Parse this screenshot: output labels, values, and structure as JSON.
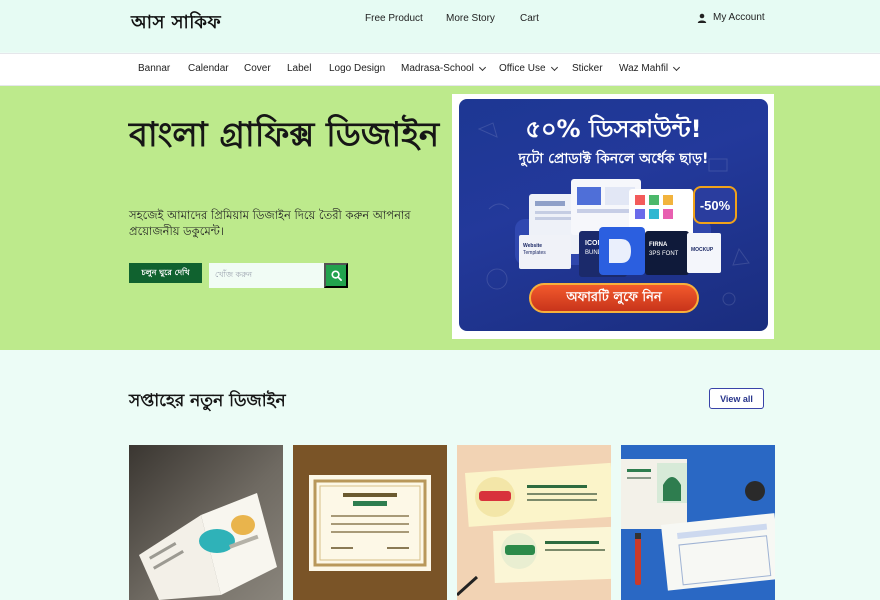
{
  "header": {
    "logo": "আস সাকিফ",
    "nav": [
      "Free Product",
      "More Story",
      "Cart"
    ],
    "account_label": "My Account"
  },
  "categories": [
    {
      "label": "Bannar",
      "has_dropdown": false
    },
    {
      "label": "Calendar",
      "has_dropdown": false
    },
    {
      "label": "Cover",
      "has_dropdown": false
    },
    {
      "label": "Label",
      "has_dropdown": false
    },
    {
      "label": "Logo Design",
      "has_dropdown": false
    },
    {
      "label": "Madrasa-School",
      "has_dropdown": true
    },
    {
      "label": "Office Use",
      "has_dropdown": true
    },
    {
      "label": "Sticker",
      "has_dropdown": false
    },
    {
      "label": "Waz Mahfil",
      "has_dropdown": true
    }
  ],
  "hero": {
    "title": "বাংলা গ্রাফিক্স ডিজাইন",
    "subtitle": "সহজেই আমাদের প্রিমিয়াম ডিজাইন দিয়ে তৈরী করুন আপনার প্রয়োজনীয় ডকুমেন্ট।",
    "explore_button": "চলুন ঘুরে দেখি",
    "search_placeholder": "খোঁজ করুন"
  },
  "promo": {
    "headline": "৫০% ডিসকাউন্ট!",
    "subline": "দুটো প্রোডাক্ট কিনলে অর্ধেক ছাড়!",
    "badge": "-50%",
    "cta": "অফারটি লুফে নিন"
  },
  "section": {
    "title": "সপ্তাহের নতুন ডিজাইন",
    "view_all": "View all"
  },
  "colors": {
    "header_bg": "#e6fbf3",
    "hero_bg": "#bdea8c",
    "primary_green": "#10622f",
    "search_green": "#22a24d",
    "promo_blue": "#23399b",
    "cta_orange": "#e94b25"
  }
}
